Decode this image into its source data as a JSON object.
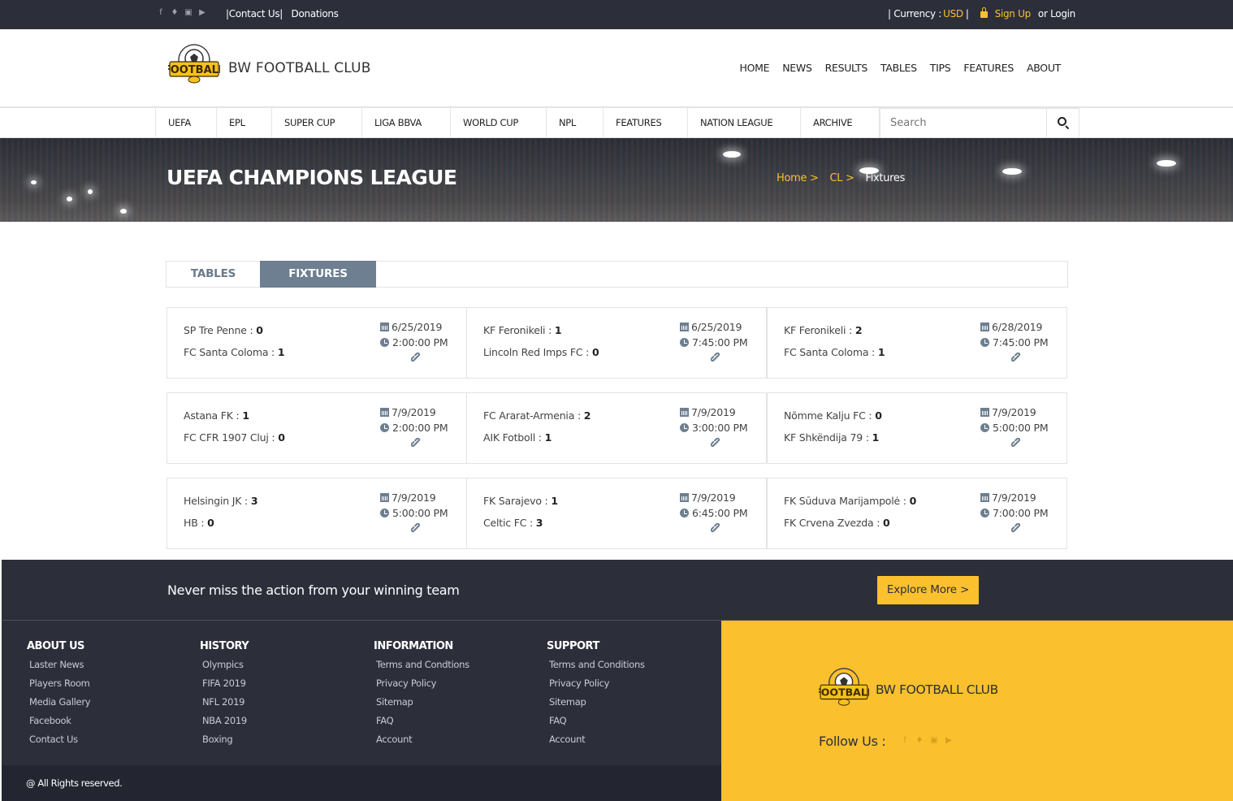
{
  "topbar": {
    "social_icons": [
      "facebook-icon",
      "twitter-icon",
      "instagram-icon",
      "youtube-icon"
    ],
    "contact": "|Contact Us|",
    "donations": "Donations",
    "currency_label": "| Currency :",
    "currency_value": "USD",
    "currency_sep": "|",
    "signup": "Sign Up",
    "login": "or Login"
  },
  "header": {
    "brand": "BW FOOTBALL CLUB",
    "nav": [
      "HOME",
      "NEWS",
      "RESULTS",
      "TABLES",
      "TIPS",
      "FEATURES",
      "ABOUT"
    ]
  },
  "catnav": {
    "items": [
      "UEFA",
      "EPL",
      "SUPER CUP",
      "LIGA BBVA",
      "WORLD CUP",
      "NPL",
      "FEATURES",
      "NATION LEAGUE",
      "ARCHIVE"
    ],
    "search_placeholder": "Search"
  },
  "banner": {
    "title": "UEFA CHAMPIONS LEAGUE",
    "crumbs": [
      "Home >",
      "CL >",
      "Fixtures"
    ]
  },
  "tabs": [
    "TABLES",
    "FIXTURES"
  ],
  "active_tab": "FIXTURES",
  "fixtures": [
    {
      "home": "SP Tre Penne :",
      "home_score": "0",
      "away": "FC Santa Coloma :",
      "away_score": "1",
      "date": "6/25/2019",
      "time": "2:00:00 PM"
    },
    {
      "home": "KF Feronikeli :",
      "home_score": "1",
      "away": "Lincoln Red Imps FC :",
      "away_score": "0",
      "date": "6/25/2019",
      "time": "7:45:00 PM"
    },
    {
      "home": "KF Feronikeli :",
      "home_score": "2",
      "away": "FC Santa Coloma :",
      "away_score": "1",
      "date": "6/28/2019",
      "time": "7:45:00 PM"
    },
    {
      "home": "Astana FK :",
      "home_score": "1",
      "away": "FC CFR 1907 Cluj :",
      "away_score": "0",
      "date": "7/9/2019",
      "time": "2:00:00 PM"
    },
    {
      "home": "FC Ararat-Armenia :",
      "home_score": "2",
      "away": "AIK Fotboll :",
      "away_score": "1",
      "date": "7/9/2019",
      "time": "3:00:00 PM"
    },
    {
      "home": "Nõmme Kalju FC :",
      "home_score": "0",
      "away": "KF Shkëndija 79 :",
      "away_score": "1",
      "date": "7/9/2019",
      "time": "5:00:00 PM"
    },
    {
      "home": "Helsingin JK :",
      "home_score": "3",
      "away": "HB :",
      "away_score": "0",
      "date": "7/9/2019",
      "time": "5:00:00 PM"
    },
    {
      "home": "FK Sarajevo :",
      "home_score": "1",
      "away": "Celtic FC :",
      "away_score": "3",
      "date": "7/9/2019",
      "time": "6:45:00 PM"
    },
    {
      "home": "FK Sūduva Marijampolė :",
      "home_score": "0",
      "away": "FK Crvena Zvezda :",
      "away_score": "0",
      "date": "7/9/2019",
      "time": "7:00:00 PM"
    }
  ],
  "cta": {
    "text": "Never miss the action from your winning team",
    "button": "Explore More >"
  },
  "footer": {
    "columns": [
      {
        "title": "ABOUT US",
        "links": [
          "Laster News",
          "Players Room",
          "Media Gallery",
          "Facebook",
          "Contact Us"
        ]
      },
      {
        "title": "HISTORY",
        "links": [
          "Olympics",
          "FIFA 2019",
          "NFL 2019",
          "NBA 2019",
          "Boxing"
        ]
      },
      {
        "title": "INFORMATION",
        "links": [
          "Terms and Condtions",
          "Privacy Policy",
          "Sitemap",
          "FAQ",
          "Account"
        ]
      },
      {
        "title": "SUPPORT",
        "links": [
          "Terms and Conditions",
          "Privacy Policy",
          "Sitemap",
          "FAQ",
          "Account"
        ]
      }
    ],
    "copyright": "@ All Rights reserved.",
    "brand": "BW FOOTBALL CLUB",
    "follow": "Follow Us :"
  },
  "colors": {
    "dark": "#2c2f3a",
    "accent": "#fbc02d",
    "tab_active": "#6d7f90"
  }
}
